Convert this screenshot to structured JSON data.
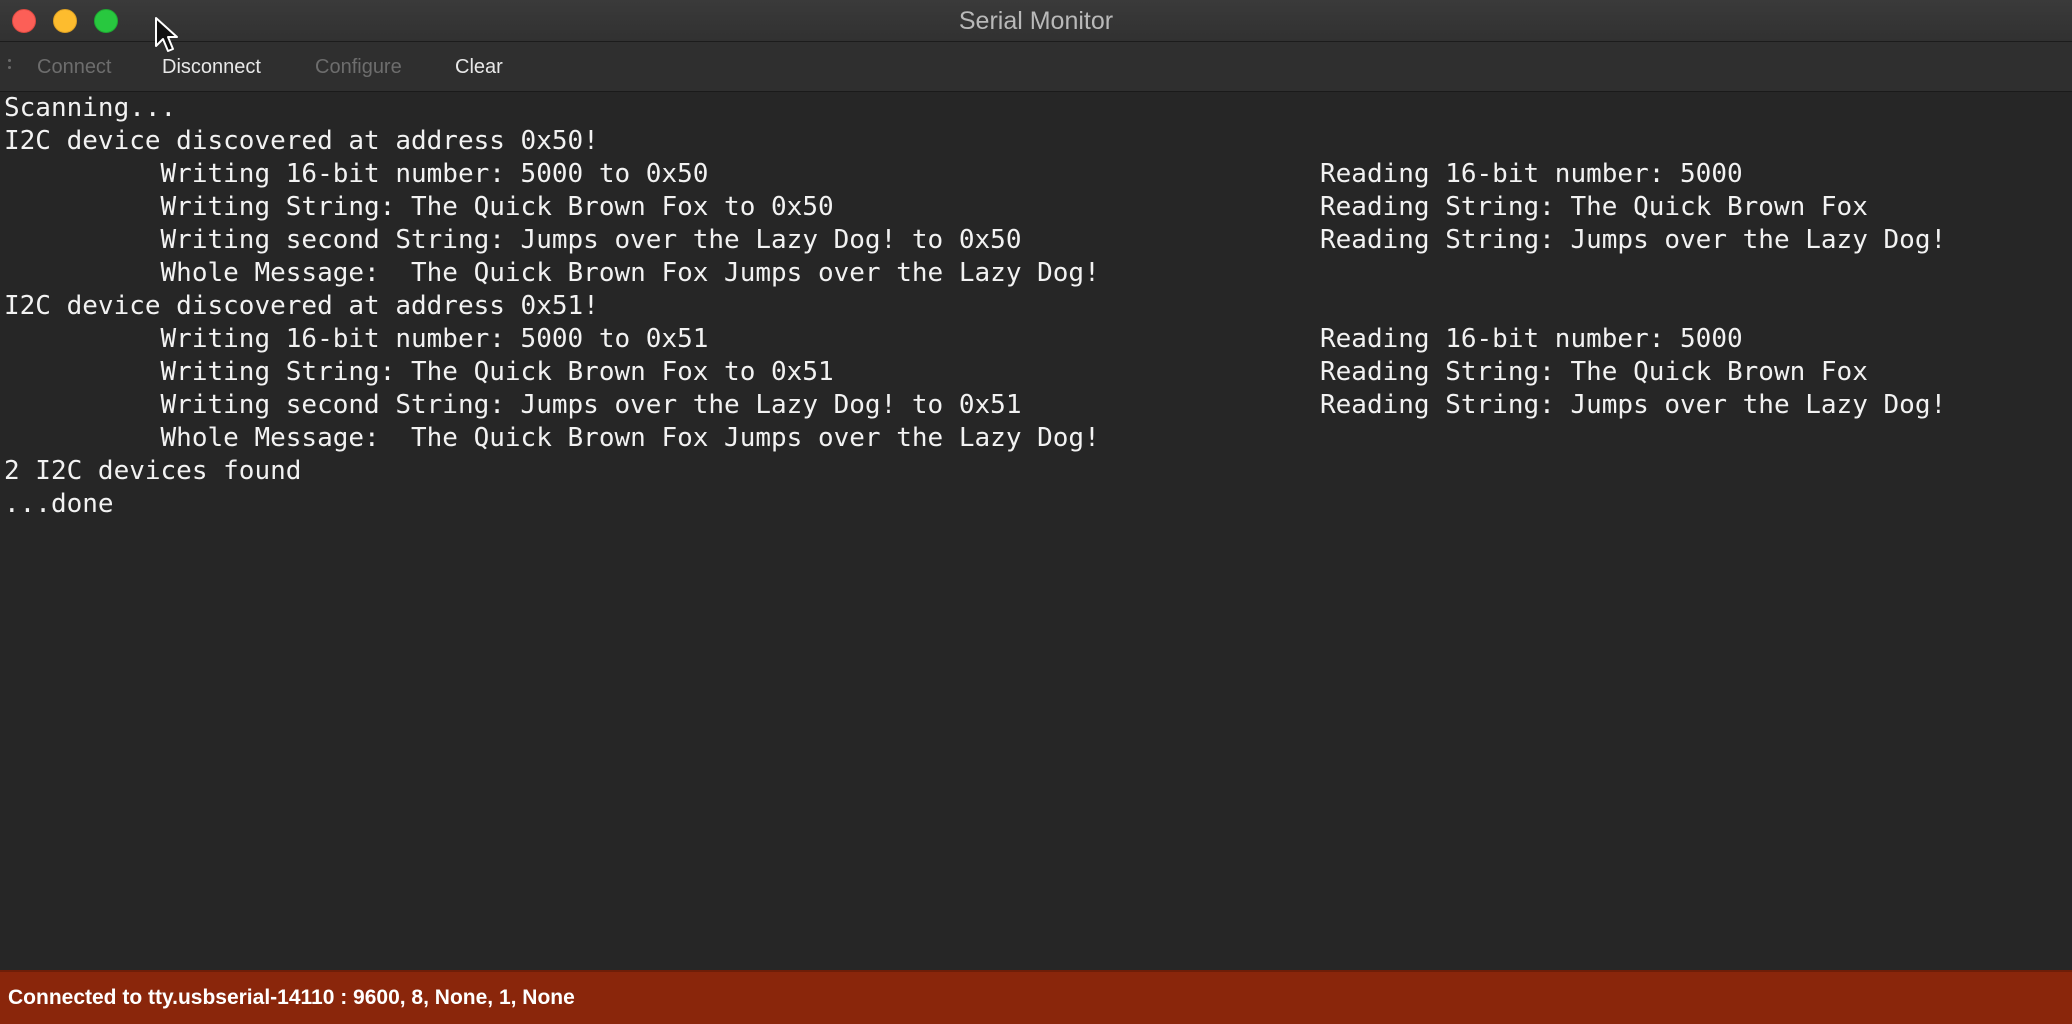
{
  "window": {
    "title": "Serial Monitor"
  },
  "toolbar": {
    "connect_label": "Connect",
    "disconnect_label": "Disconnect",
    "configure_label": "Configure",
    "clear_label": "Clear"
  },
  "console": {
    "lines": [
      "Scanning...",
      "I2C device discovered at address 0x50!",
      "          Writing 16-bit number: 5000 to 0x50",
      "          Writing String: The Quick Brown Fox to 0x50",
      "          Writing second String: Jumps over the Lazy Dog! to 0x50",
      "          Whole Message:  The Quick Brown Fox Jumps over the Lazy Dog!",
      "I2C device discovered at address 0x51!",
      "          Writing 16-bit number: 5000 to 0x51",
      "          Writing String: The Quick Brown Fox to 0x51",
      "          Writing second String: Jumps over the Lazy Dog! to 0x51",
      "          Whole Message:  The Quick Brown Fox Jumps over the Lazy Dog!",
      "2 I2C devices found",
      "...done"
    ],
    "right_column": [
      "Reading 16-bit number: 5000",
      "Reading String: The Quick Brown Fox",
      "Reading String: Jumps over the Lazy Dog!",
      "Reading 16-bit number: 5000",
      "Reading String: The Quick Brown Fox",
      "Reading String: Jumps over the Lazy Dog!"
    ]
  },
  "status": {
    "text": "Connected to tty.usbserial-14110 : 9600, 8, None, 1, None"
  },
  "colors": {
    "background": "#262626",
    "status_bar": "#8a260b",
    "close": "#fc5f57",
    "minimize": "#fdbc2e",
    "zoom": "#28c83f"
  }
}
